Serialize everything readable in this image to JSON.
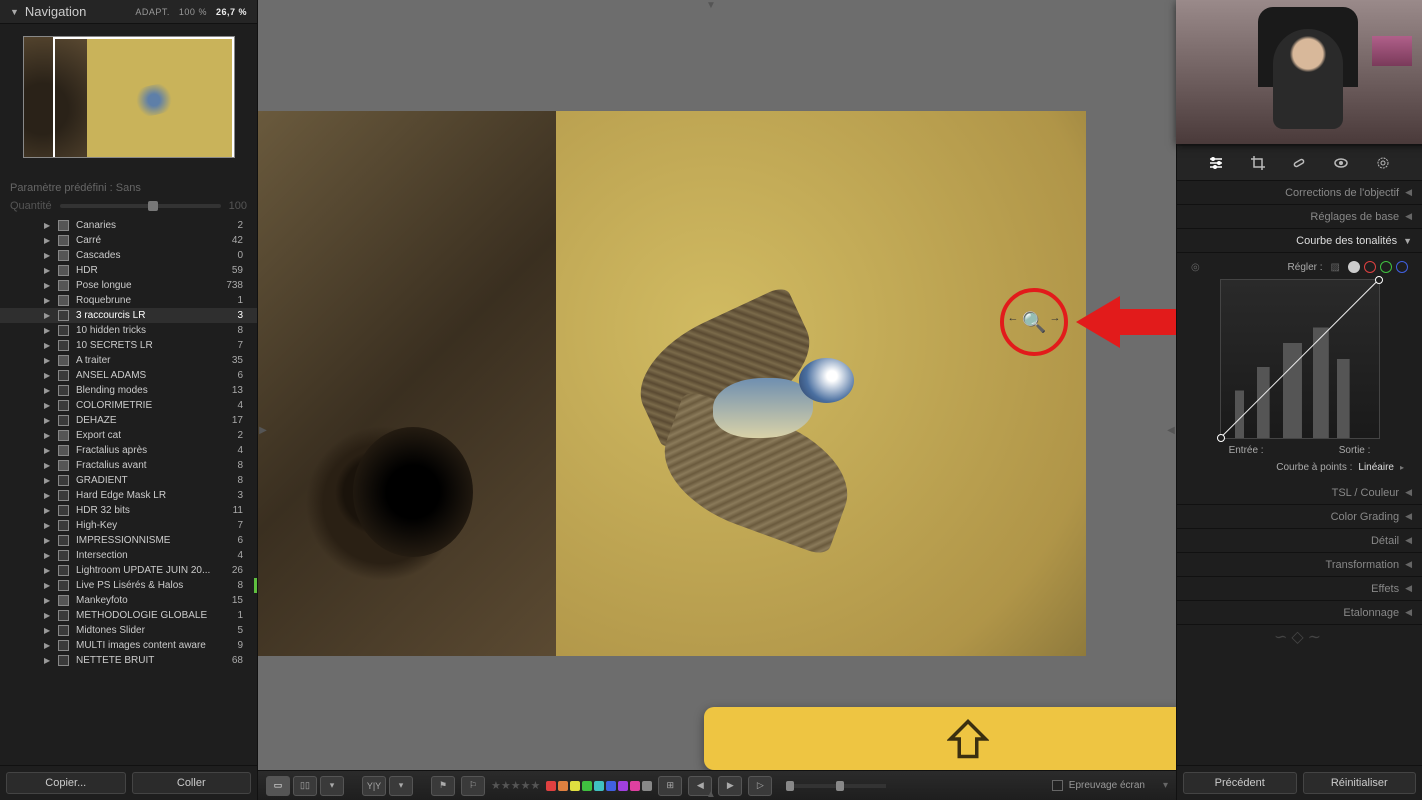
{
  "nav": {
    "title": "Navigation",
    "zoom_mode": "ADAPT.",
    "zoom_100": "100 %",
    "zoom_current": "26,7 %"
  },
  "preset": {
    "label": "Paramètre prédéfini :",
    "value": "Sans",
    "qty_label": "Quantité",
    "qty_value": "100"
  },
  "folders": [
    {
      "name": "Canaries",
      "count": 2
    },
    {
      "name": "Carré",
      "count": 42
    },
    {
      "name": "Cascades",
      "count": 0
    },
    {
      "name": "HDR",
      "count": 59
    },
    {
      "name": "Pose longue",
      "count": 738
    },
    {
      "name": "Roquebrune",
      "count": 1
    },
    {
      "name": "3 raccourcis LR",
      "count": 3,
      "selected": true,
      "gray": true
    },
    {
      "name": "10 hidden tricks",
      "count": 8,
      "gray": true
    },
    {
      "name": "10 SECRETS LR",
      "count": 7,
      "gray": true
    },
    {
      "name": "A traiter",
      "count": 35
    },
    {
      "name": "ANSEL ADAMS",
      "count": 6,
      "gray": true
    },
    {
      "name": "Blending modes",
      "count": 13,
      "gray": true
    },
    {
      "name": "COLORIMETRIE",
      "count": 4,
      "gray": true
    },
    {
      "name": "DEHAZE",
      "count": 17,
      "gray": true
    },
    {
      "name": "Export cat",
      "count": 2
    },
    {
      "name": "Fractalius après",
      "count": 4
    },
    {
      "name": "Fractalius avant",
      "count": 8
    },
    {
      "name": "GRADIENT",
      "count": 8,
      "gray": true
    },
    {
      "name": "Hard Edge Mask LR",
      "count": 3,
      "gray": true
    },
    {
      "name": "HDR 32 bits",
      "count": 11,
      "gray": true
    },
    {
      "name": "High-Key",
      "count": 7,
      "gray": true
    },
    {
      "name": "IMPRESSIONNISME",
      "count": 6,
      "gray": true
    },
    {
      "name": "Intersection",
      "count": 4,
      "gray": true
    },
    {
      "name": "Lightroom UPDATE JUIN 20...",
      "count": 26,
      "gray": true
    },
    {
      "name": "Live PS Lisérés & Halos",
      "count": 8,
      "gray": true,
      "green": true
    },
    {
      "name": "Mankeyfoto",
      "count": 15
    },
    {
      "name": "MÉTHODOLOGIE GLOBALE",
      "count": 1,
      "gray": true
    },
    {
      "name": "Midtones Slider",
      "count": 5,
      "gray": true
    },
    {
      "name": "MULTI images content aware",
      "count": 9,
      "gray": true
    },
    {
      "name": "NETTETE BRUIT",
      "count": 68,
      "gray": true
    }
  ],
  "left_buttons": {
    "copy": "Copier...",
    "paste": "Coller"
  },
  "tools": {
    "icons": [
      "sliders",
      "crop",
      "heal",
      "eye",
      "radial"
    ]
  },
  "right_panels": {
    "lens": "Corrections de l'objectif",
    "basic": "Réglages de base",
    "tone_curve": "Courbe des tonalités",
    "tsl": "TSL / Couleur",
    "grading": "Color Grading",
    "detail": "Détail",
    "transform": "Transformation",
    "effects": "Effets",
    "calibration": "Etalonnage"
  },
  "curve": {
    "adjust_label": "Régler :",
    "input_label": "Entrée :",
    "output_label": "Sortie :",
    "point_label": "Courbe à points :",
    "point_value": "Linéaire",
    "channels": [
      "#cccccc",
      "#e04040",
      "#40c040",
      "#4060e0"
    ]
  },
  "right_buttons": {
    "prev": "Précédent",
    "reset": "Réinitialiser"
  },
  "bottom": {
    "proof_label": "Epreuvage écran",
    "swatches": [
      "#e04040",
      "#e08040",
      "#e0e040",
      "#40c040",
      "#40c0c0",
      "#4060e0",
      "#a040e0",
      "#e040a0",
      "#888"
    ]
  },
  "annotation": {
    "circle_icon": "zoom-scrub",
    "key_hint": "shift"
  }
}
